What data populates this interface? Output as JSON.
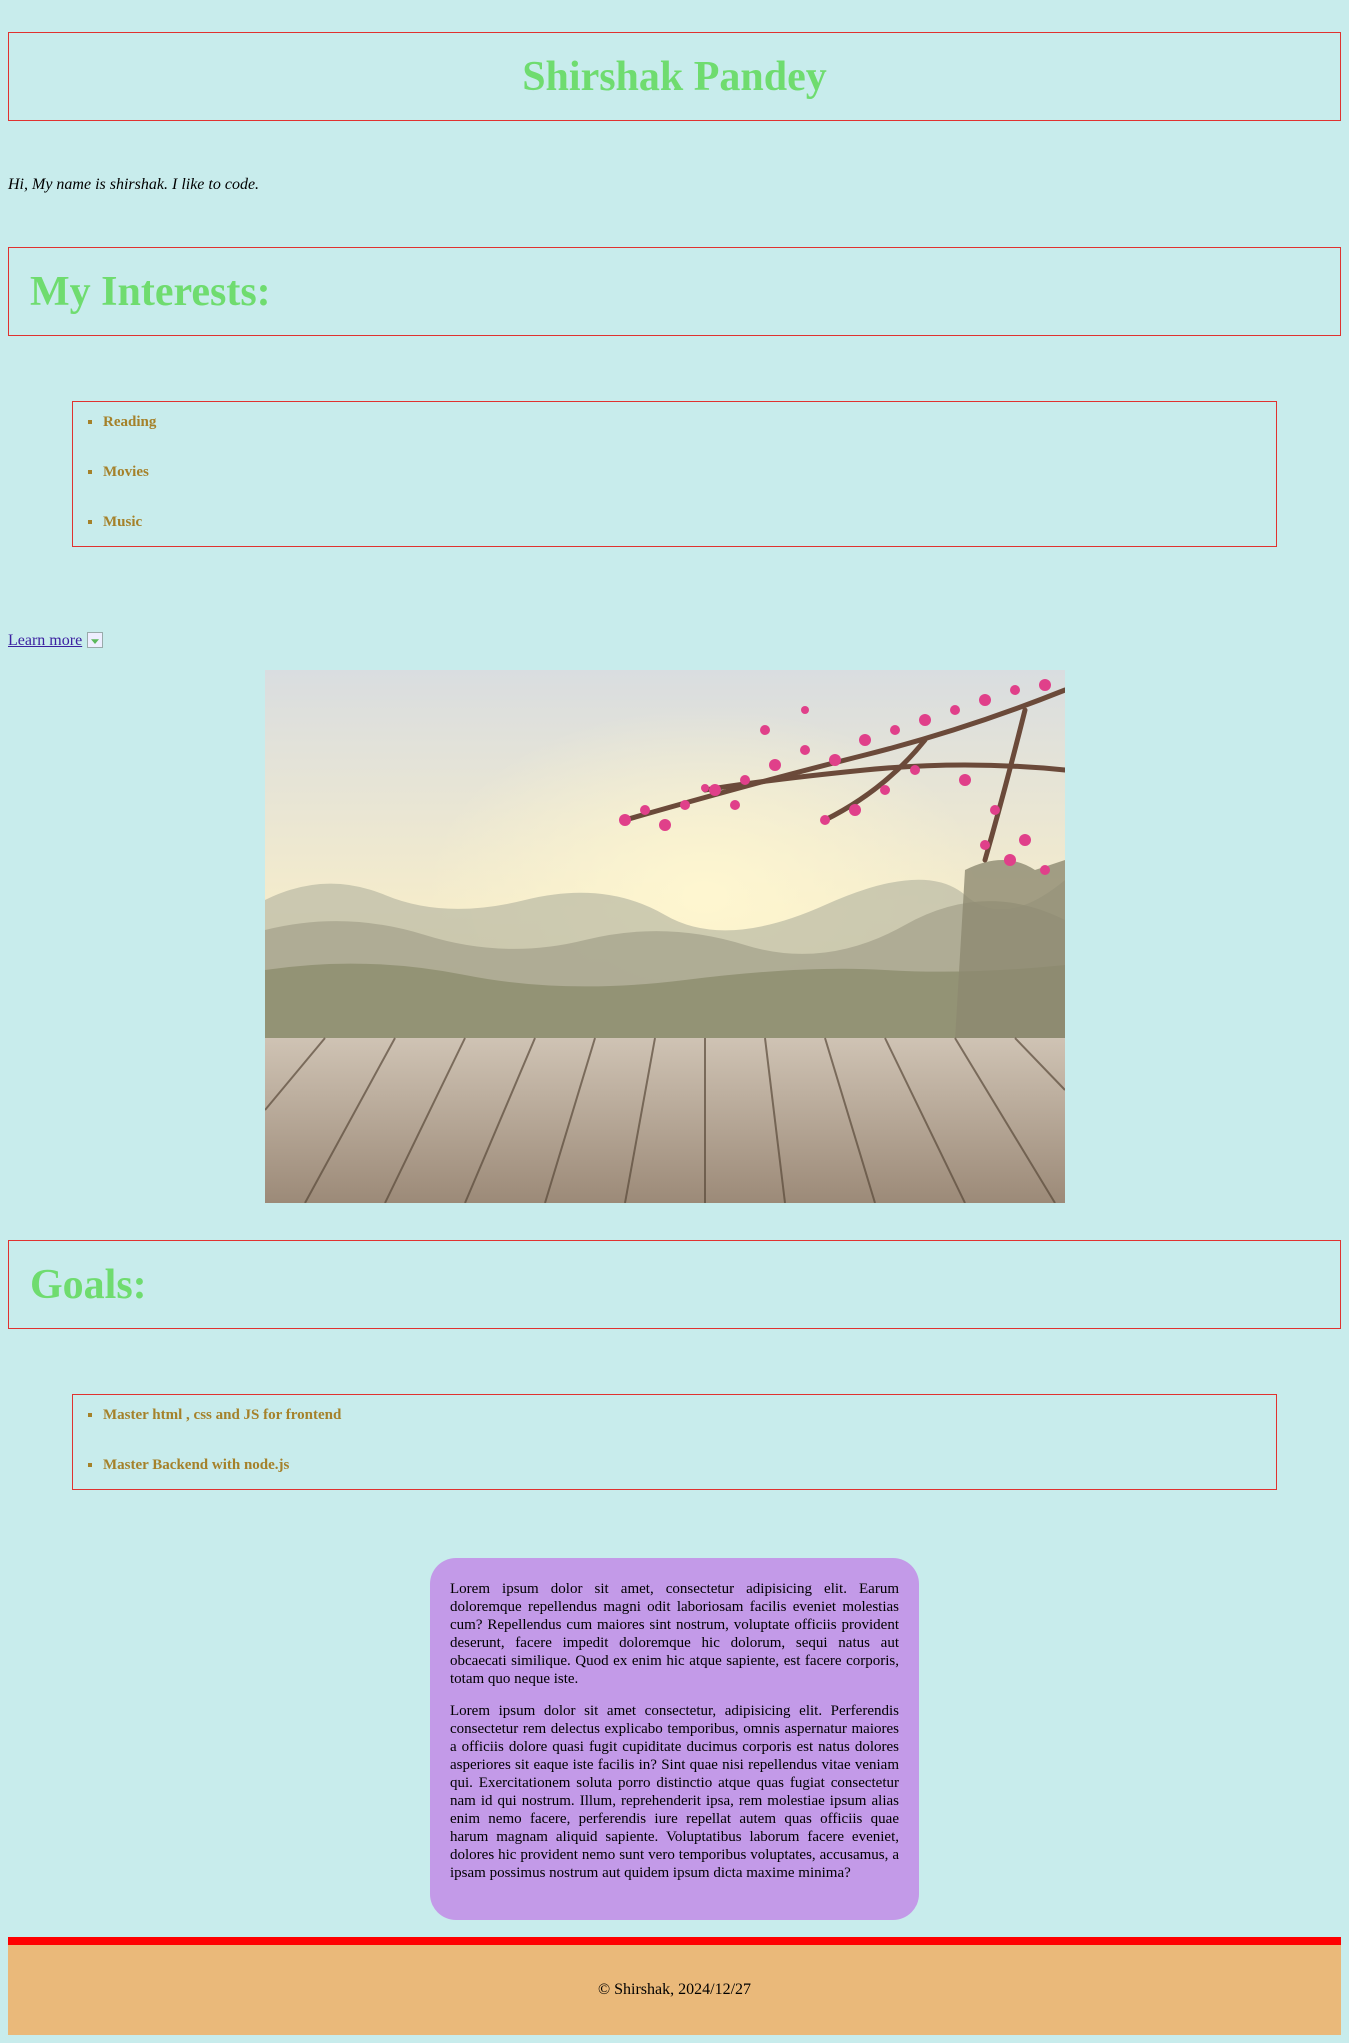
{
  "header": {
    "title": "Shirshak Pandey"
  },
  "intro": "Hi, My name is shirshak. I like to code.",
  "interests": {
    "heading": "My Interests:",
    "items": [
      "Reading",
      "Movies",
      "Music"
    ]
  },
  "learn_more": {
    "label": "Learn more",
    "icon": "broken-image-icon"
  },
  "goals": {
    "heading": "Goals:",
    "items": [
      "Master html , css and JS for frontend",
      "Master Backend with node.js"
    ]
  },
  "about": {
    "paragraphs": [
      "Lorem ipsum dolor sit amet, consectetur adipisicing elit. Earum doloremque repellendus magni odit laboriosam facilis eveniet molestias cum? Repellendus cum maiores sint nostrum, voluptate officiis provident deserunt, facere impedit doloremque hic dolorum, sequi natus aut obcaecati similique. Quod ex enim hic atque sapiente, est facere corporis, totam quo neque iste.",
      "Lorem ipsum dolor sit amet consectetur, adipisicing elit. Perferendis consectetur rem delectus explicabo temporibus, omnis aspernatur maiores a officiis dolore quasi fugit cupiditate ducimus corporis est natus dolores asperiores sit eaque iste facilis in? Sint quae nisi repellendus vitae veniam qui. Exercitationem soluta porro distinctio atque quas fugiat consectetur nam id qui nostrum. Illum, reprehenderit ipsa, rem molestiae ipsum alias enim nemo facere, perferendis iure repellat autem quas officiis quae harum magnam aliquid sapiente. Voluptatibus laborum facere eveniet, dolores hic provident nemo sunt vero temporibus voluptates, accusamus, a ipsam possimus nostrum aut quidem ipsum dicta maxime minima?"
    ]
  },
  "footer": {
    "text": "© Shirshak, 2024/12/27"
  },
  "colors": {
    "background": "#c8ecec",
    "heading": "#6fdc6f",
    "border": "#e0322f",
    "list_text": "#a5812a",
    "card": "#c39ae8",
    "footer": "#eab97a",
    "footer_bar": "#ff0000"
  }
}
